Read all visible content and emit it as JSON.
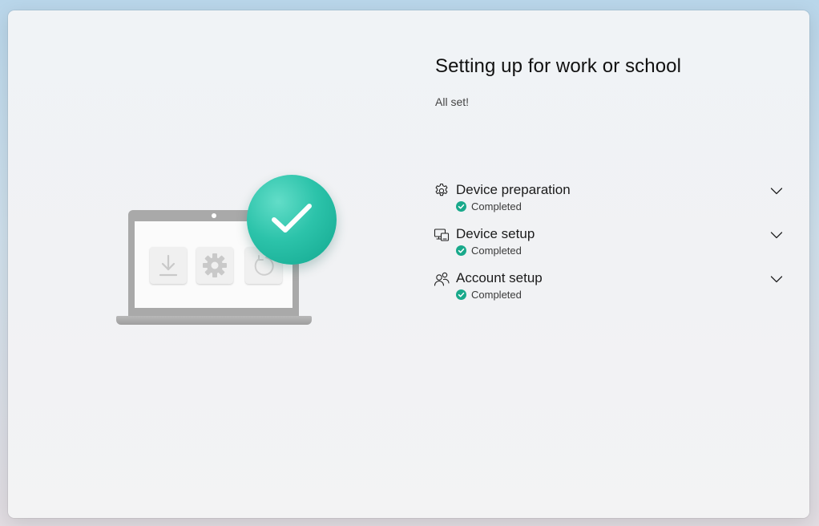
{
  "page": {
    "title": "Setting up for work or school",
    "subtitle": "All set!"
  },
  "steps": [
    {
      "label": "Device preparation",
      "status": "Completed",
      "icon": "gear-icon",
      "status_icon": "check-circle-icon"
    },
    {
      "label": "Device setup",
      "status": "Completed",
      "icon": "devices-icon",
      "status_icon": "check-circle-icon"
    },
    {
      "label": "Account setup",
      "status": "Completed",
      "icon": "people-icon",
      "status_icon": "check-circle-icon"
    }
  ],
  "illustration": {
    "icons": [
      "download-icon",
      "gear-icon",
      "refresh-icon",
      "checkmark-icon"
    ]
  },
  "colors": {
    "accent": "#1fb59b",
    "status_success": "#19a98b",
    "text_primary": "#111111"
  }
}
